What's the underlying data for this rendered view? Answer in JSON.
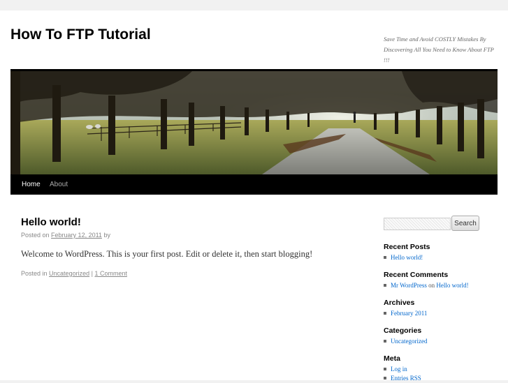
{
  "site": {
    "title": "How To FTP Tutorial",
    "description": "Save Time and Avoid COSTLY Mistakes By Discovering All You Need to Know About FTP !!!"
  },
  "nav": {
    "items": [
      {
        "label": "Home",
        "current": true
      },
      {
        "label": "About",
        "current": false
      }
    ]
  },
  "post": {
    "title": "Hello world!",
    "posted_on_label": "Posted on",
    "date": "February 12, 2011",
    "by_label": "by",
    "content": "Welcome to WordPress. This is your first post. Edit or delete it, then start blogging!",
    "posted_in_label": "Posted in",
    "category": "Uncategorized",
    "separator": "|",
    "comments_link": "1 Comment"
  },
  "sidebar": {
    "search": {
      "value": "",
      "button_label": "Search"
    },
    "recent_posts": {
      "title": "Recent Posts",
      "items": [
        "Hello world!"
      ]
    },
    "recent_comments": {
      "title": "Recent Comments",
      "items": [
        {
          "author": "Mr WordPress",
          "on_label": "on",
          "post": "Hello world!"
        }
      ]
    },
    "archives": {
      "title": "Archives",
      "items": [
        "February 2011"
      ]
    },
    "categories": {
      "title": "Categories",
      "items": [
        "Uncategorized"
      ]
    },
    "meta": {
      "title": "Meta",
      "items": [
        "Log in",
        "Entries RSS"
      ]
    }
  },
  "colors": {
    "link": "#0066cc",
    "nav_bg": "#000000",
    "page_bg": "#f1f1f1"
  }
}
